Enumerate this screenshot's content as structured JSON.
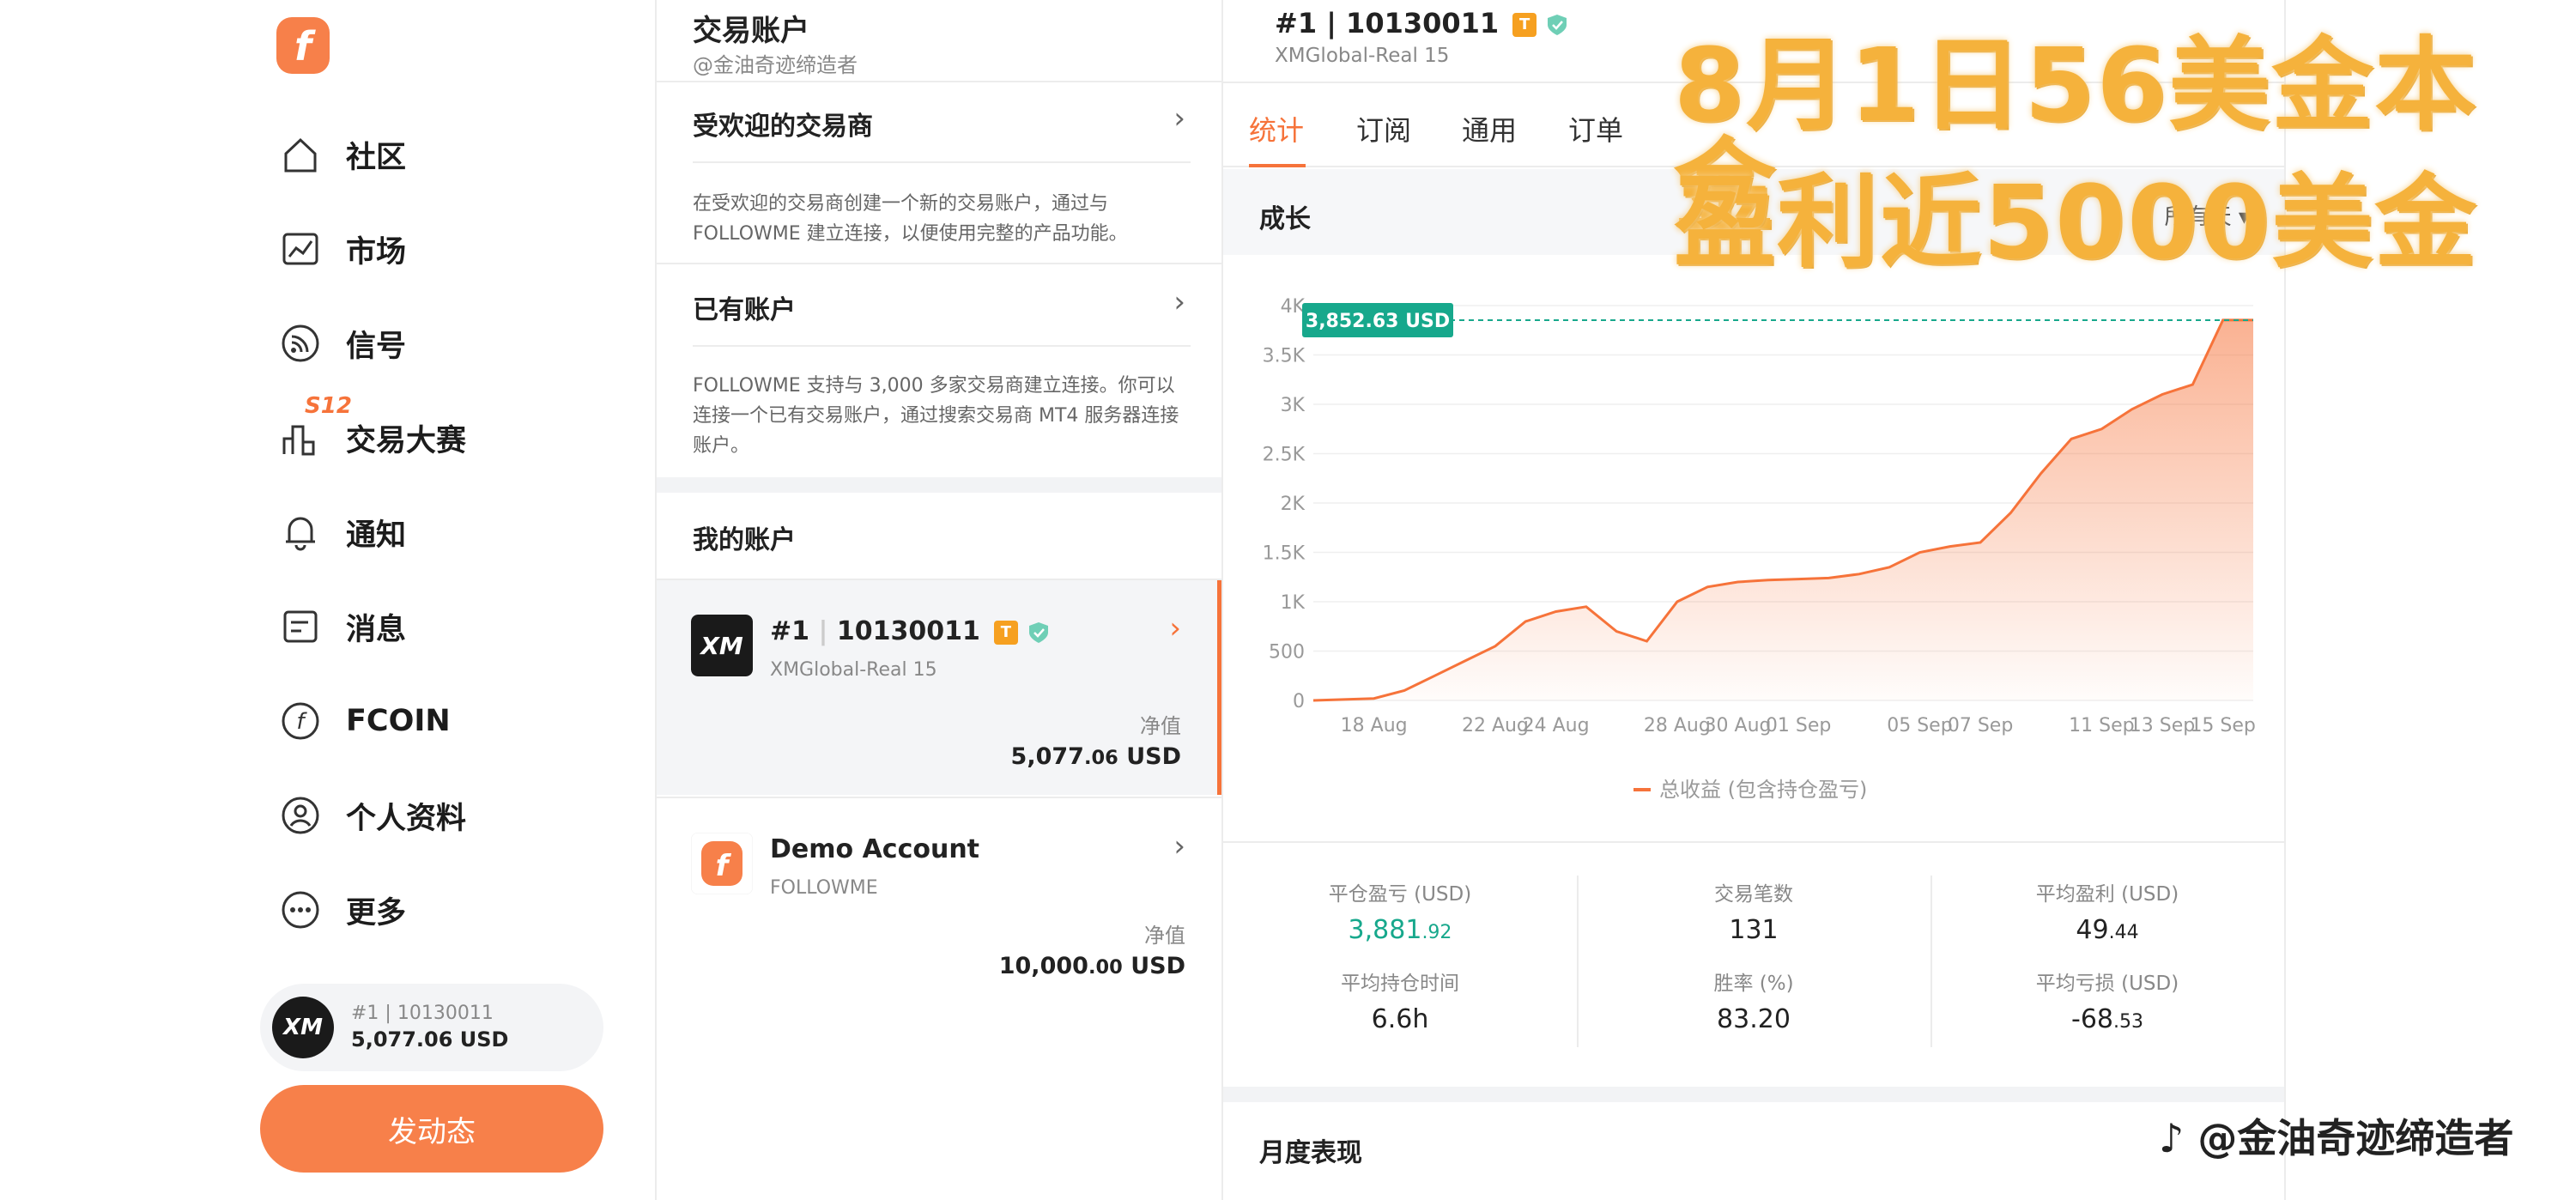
{
  "nav": {
    "items": [
      {
        "label": "社区",
        "icon": "home-icon"
      },
      {
        "label": "市场",
        "icon": "chart-icon"
      },
      {
        "label": "信号",
        "icon": "signal-icon"
      },
      {
        "label": "交易大赛",
        "icon": "contest-icon"
      },
      {
        "label": "通知",
        "icon": "bell-icon"
      },
      {
        "label": "消息",
        "icon": "message-icon"
      },
      {
        "label": "FCOIN",
        "icon": "coin-icon"
      },
      {
        "label": "个人资料",
        "icon": "user-icon"
      },
      {
        "label": "更多",
        "icon": "more-icon"
      }
    ],
    "contest_badge": "S12",
    "mini_account": {
      "id": "#1",
      "number": "10130011",
      "balance": "5,077.06 USD",
      "logo": "XM"
    },
    "post_button": "发动态"
  },
  "middle": {
    "title": "交易账户",
    "subtitle": "@金油奇迹缔造者",
    "popular": {
      "title": "受欢迎的交易商",
      "desc": "在受欢迎的交易商创建一个新的交易账户，通过与 FOLLOWME 建立连接，以便使用完整的产品功能。"
    },
    "existing": {
      "title": "已有账户",
      "desc": "FOLLOWME 支持与 3,000 多家交易商建立连接。你可以连接一个已有交易账户，通过搜索交易商 MT4 服务器连接账户。"
    },
    "my_accounts": {
      "title": "我的账户",
      "items": [
        {
          "id": "#1",
          "number": "10130011",
          "broker": "XMGlobal-Real 15",
          "label": "净值",
          "balance_main": "5,077",
          "balance_dec": ".06",
          "currency": "USD",
          "logo": "XM"
        },
        {
          "name": "Demo Account",
          "broker": "FOLLOWME",
          "label": "净值",
          "balance_main": "10,000",
          "balance_dec": ".00",
          "currency": "USD"
        }
      ]
    }
  },
  "right": {
    "account_id": "#1",
    "account_number": "10130011",
    "broker": "XMGlobal-Real 15",
    "tag": "T",
    "tabs": [
      "统计",
      "订阅",
      "通用",
      "订单"
    ],
    "growth_title": "成长",
    "range_label": "所有天",
    "stats": [
      {
        "label": "平仓盈亏 (USD)",
        "main": "3,881",
        "dec": ".92"
      },
      {
        "label": "交易笔数",
        "main": "131",
        "dec": ""
      },
      {
        "label": "平均盈利 (USD)",
        "main": "49",
        "dec": ".44"
      },
      {
        "label": "平均持仓时间",
        "main": "6.6h",
        "dec": ""
      },
      {
        "label": "胜率 (%)",
        "main": "83.20",
        "dec": ""
      },
      {
        "label": "平均亏损 (USD)",
        "main": "-68",
        "dec": ".53"
      }
    ],
    "monthly_title": "月度表现"
  },
  "overlay": {
    "line1": "8月1日56美金本金",
    "line2": "盈利近5000美金",
    "watermark": "@金油奇迹缔造者"
  },
  "colors": {
    "accent": "#f6733a",
    "green": "#17a88c",
    "overlay": "#f5b23c"
  },
  "chart_data": {
    "type": "area",
    "x": [
      "16 Aug",
      "17 Aug",
      "18 Aug",
      "19 Aug",
      "20 Aug",
      "21 Aug",
      "22 Aug",
      "23 Aug",
      "24 Aug",
      "25 Aug",
      "26 Aug",
      "27 Aug",
      "28 Aug",
      "29 Aug",
      "30 Aug",
      "31 Aug",
      "01 Sep",
      "02 Sep",
      "03 Sep",
      "04 Sep",
      "05 Sep",
      "06 Sep",
      "07 Sep",
      "08 Sep",
      "09 Sep",
      "10 Sep",
      "11 Sep",
      "12 Sep",
      "13 Sep",
      "14 Sep",
      "15 Sep",
      "16 Sep"
    ],
    "xticks": [
      "18 Aug",
      "22 Aug",
      "24 Aug",
      "28 Aug",
      "30 Aug",
      "01 Sep",
      "05 Sep",
      "07 Sep",
      "11 Sep",
      "13 Sep",
      "15 Sep"
    ],
    "series": [
      {
        "name": "总收益 (包含持仓盈亏)",
        "values": [
          0,
          10,
          20,
          100,
          250,
          400,
          550,
          800,
          900,
          950,
          700,
          600,
          1000,
          1150,
          1200,
          1220,
          1230,
          1240,
          1280,
          1350,
          1500,
          1560,
          1600,
          1900,
          2300,
          2650,
          2750,
          2950,
          3100,
          3200,
          3852.63,
          3852.63
        ]
      }
    ],
    "ylim": [
      0,
      4000
    ],
    "yticks": [
      "0",
      "500",
      "1K",
      "1.5K",
      "2K",
      "2.5K",
      "3K",
      "3.5K",
      "4K"
    ],
    "tooltip": "3,852.63 USD",
    "grid": true,
    "legend": "bottom-center"
  }
}
